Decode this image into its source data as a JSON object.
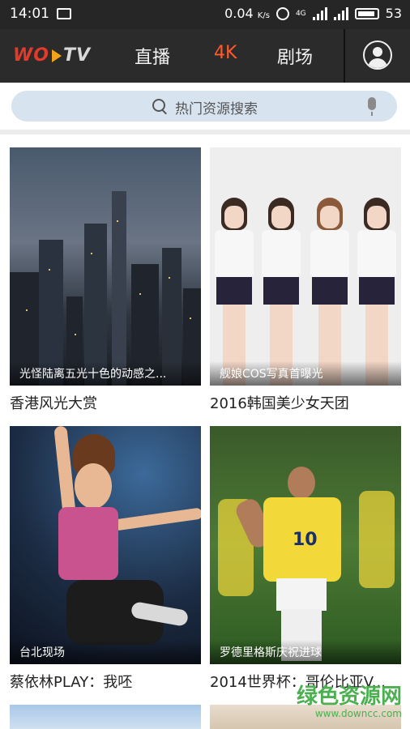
{
  "status_bar": {
    "time": "14:01",
    "net_speed": "0.04",
    "net_unit": "K/s",
    "network_type": "4G",
    "battery": "53"
  },
  "header": {
    "logo_brand": "WO",
    "logo_tv": "TV",
    "tabs": [
      {
        "label": "直播",
        "active": false
      },
      {
        "label": "4K",
        "active": true
      },
      {
        "label": "剧场",
        "active": false
      }
    ],
    "accent_color": "#ff5a2b"
  },
  "search": {
    "placeholder": "热门资源搜索"
  },
  "cards": [
    {
      "caption": "光怪陆离五光十色的动感之...",
      "title": "香港风光大赏"
    },
    {
      "caption": "舰娘COS写真首曝光",
      "title": "2016韩国美少女天团"
    },
    {
      "caption": "台北现场",
      "title": "蔡依林PLAY：我呸"
    },
    {
      "caption": "罗德里格斯庆祝进球",
      "title": "2014世界杯：哥伦比亚V..."
    }
  ],
  "player_number": "10",
  "watermark": {
    "line1": "绿色资源网",
    "line2": "www.downcc.com"
  }
}
